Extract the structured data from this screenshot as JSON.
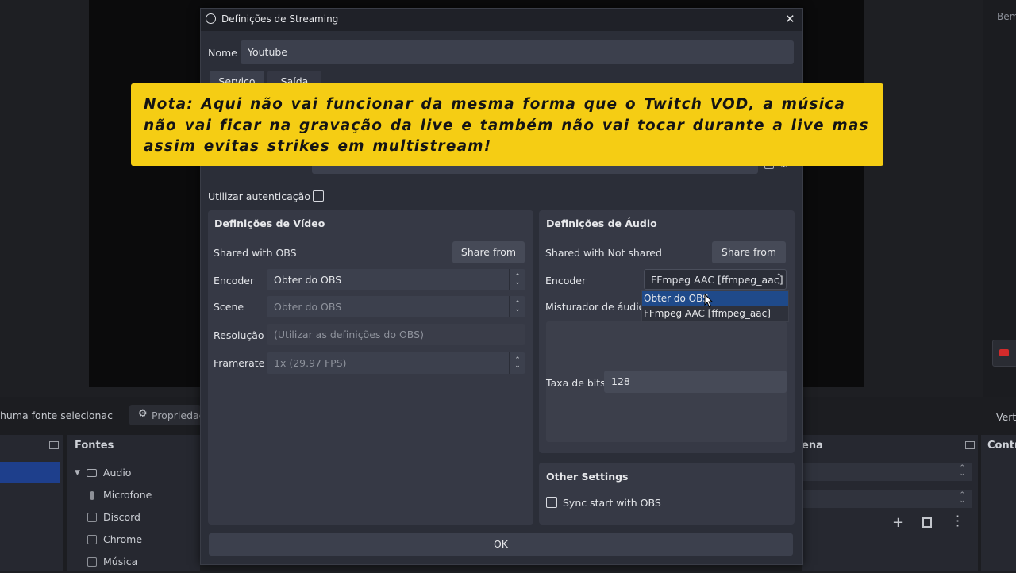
{
  "background": {
    "top_right_text": "Bem",
    "bottom_left_text": "huma fonte selecionac",
    "properties_label": "Propriedac",
    "sources_title": "Fontes",
    "scene_title": "ena",
    "controls_title": "Contr",
    "right_edge_text": "Verti",
    "sources": [
      {
        "label": "Audio",
        "icon": "folder-icon"
      },
      {
        "label": "Microfone",
        "icon": "microphone-icon"
      },
      {
        "label": "Discord",
        "icon": "audio-capture-icon"
      },
      {
        "label": "Chrome",
        "icon": "audio-capture-icon"
      },
      {
        "label": "Música",
        "icon": "audio-capture-icon"
      }
    ]
  },
  "dialog": {
    "title": "Definições de Streaming",
    "name_label": "Nome",
    "name_value": "Youtube",
    "tabs": [
      "Serviço",
      "Saída"
    ],
    "auth_label": "Utilizar autenticação",
    "ok_label": "OK"
  },
  "video": {
    "title": "Definições de Vídeo",
    "shared_label": "Shared with OBS",
    "share_button": "Share from",
    "encoder_label": "Encoder",
    "encoder_value": "Obter do OBS",
    "scene_label": "Scene",
    "scene_value": "Obter do OBS",
    "resolution_label": "Resolução",
    "resolution_placeholder": "(Utilizar as definições do OBS)",
    "framerate_label": "Framerate",
    "framerate_value": "1x (29.97 FPS)"
  },
  "audio": {
    "title": "Definições de Áudio",
    "shared_label": "Shared with Not shared",
    "share_button": "Share from",
    "encoder_label": "Encoder",
    "encoder_value": "FFmpeg AAC [ffmpeg_aac]",
    "mixer_label": "Misturador de áudio",
    "bitrate_label": "Taxa de bits",
    "bitrate_value": "128",
    "dropdown_options": [
      "Obter do OBS",
      "FFmpeg AAC [ffmpeg_aac]"
    ]
  },
  "other": {
    "title": "Other Settings",
    "sync_label": "Sync start with OBS"
  },
  "note": {
    "text": "Nota: Aqui não vai funcionar da mesma forma que o Twitch VOD, a música não vai ficar na gravação da live  e também não vai tocar durante a live mas assim evitas strikes em multistream!"
  },
  "colors": {
    "note_bg": "#f5cd14",
    "dialog_bg": "#2b2e38",
    "selection": "#1f4a8a",
    "record_red": "#d22b2b"
  }
}
